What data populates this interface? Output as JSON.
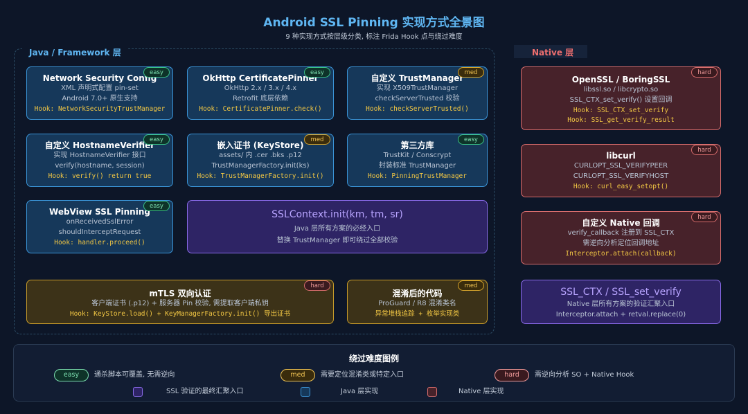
{
  "header": {
    "title": "Android SSL Pinning 实现方式全景图",
    "subtitle": "9 种实现方式按层级分类, 标注 Frida Hook 点与绕过难度"
  },
  "regions": {
    "java_label": "Java / Framework 层",
    "native_label": "Native 层"
  },
  "cards": {
    "network_security_config": {
      "title": "Network Security Config",
      "badge": "easy",
      "line1": "XML 声明式配置 pin-set",
      "line2": "Android 7.0+ 原生支持",
      "hook": "Hook: NetworkSecurityTrustManager"
    },
    "okhttp": {
      "title": "OkHttp CertificatePinner",
      "badge": "easy",
      "line1": "OkHttp 2.x / 3.x / 4.x",
      "line2": "Retrofit 底层依赖",
      "hook": "Hook: CertificatePinner.check()"
    },
    "custom_trustmanager": {
      "title": "自定义 TrustManager",
      "badge": "med",
      "line1": "实现 X509TrustManager",
      "line2": "checkServerTrusted 校验",
      "hook": "Hook: checkServerTrusted()"
    },
    "hostname_verifier": {
      "title": "自定义 HostnameVerifier",
      "badge": "easy",
      "line1": "实现 HostnameVerifier 接口",
      "line2": "verify(hostname, session)",
      "hook": "Hook: verify() return true"
    },
    "keystore": {
      "title": "嵌入证书 (KeyStore)",
      "badge": "med",
      "line1": "assets/ 内 .cer .bks .p12",
      "line2": "TrustManagerFactory.init(ks)",
      "hook": "Hook: TrustManagerFactory.init()"
    },
    "third_party": {
      "title": "第三方库",
      "badge": "easy",
      "line1": "TrustKit / Conscrypt",
      "line2": "封装标准 TrustManager",
      "hook": "Hook: PinningTrustManager"
    },
    "webview": {
      "title": "WebView SSL Pinning",
      "badge": "easy",
      "line1": "onReceivedSslError",
      "line2": "shouldInterceptRequest",
      "hook": "Hook: handler.proceed()"
    },
    "sslcontext": {
      "title": "SSLContext.init(km, tm, sr)",
      "line1": "Java 层所有方案的必经入口",
      "line2": "替换 TrustManager 即可绕过全部校验"
    },
    "mtls": {
      "title": "mTLS 双向认证",
      "badge": "hard",
      "line1": "客户端证书 (.p12) + 服务器 Pin 校验, 需提取客户端私钥",
      "hook": "Hook: KeyStore.load() + KeyManagerFactory.init() 导出证书"
    },
    "obfuscated": {
      "title": "混淆后的代码",
      "badge": "med",
      "line1": "ProGuard / R8 混淆类名",
      "hook": "异常堆栈追踪 + 枚举实现类"
    },
    "openssl": {
      "title": "OpenSSL / BoringSSL",
      "badge": "hard",
      "line1": "libssl.so / libcrypto.so",
      "line2": "SSL_CTX_set_verify() 设置回调",
      "hook1": "Hook: SSL_CTX_set_verify",
      "hook2": "Hook: SSL_get_verify_result"
    },
    "libcurl": {
      "title": "libcurl",
      "badge": "hard",
      "line1": "CURLOPT_SSL_VERIFYPEER",
      "line2": "CURLOPT_SSL_VERIFYHOST",
      "hook": "Hook: curl_easy_setopt()"
    },
    "native_callback": {
      "title": "自定义 Native 回调",
      "badge": "hard",
      "line1": "verify_callback 注册到 SSL_CTX",
      "line2": "需逆向分析定位回调地址",
      "hook": "Interceptor.attach(callback)"
    },
    "ssl_ctx": {
      "title": "SSL_CTX / SSL_set_verify",
      "line1": "Native 层所有方案的验证汇聚入口",
      "line2": "Interceptor.attach + retval.replace(0)"
    }
  },
  "legend": {
    "title": "绕过难度图例",
    "easy_pill": "easy",
    "easy_text": "通杀脚本可覆盖, 无需逆向",
    "med_pill": "med",
    "med_text": "需要定位混淆类或特定入口",
    "hard_pill": "hard",
    "hard_text": "需逆向分析 SO + Native Hook",
    "purple_text": "SSL 验证的最终汇聚入口",
    "blue_text": "Java 层实现",
    "red_text": "Native 层实现"
  },
  "colors": {
    "background": "#0d1628",
    "title": "#5fb6f2",
    "java_card": "#3b95d8",
    "native_card": "#d86d6d",
    "yellow_card": "#c89c2a",
    "purple_card": "#8a6bea",
    "easy": "#3ac186",
    "med": "#d6a52c",
    "hard": "#d86d6d",
    "hook_text": "#f2c744"
  }
}
